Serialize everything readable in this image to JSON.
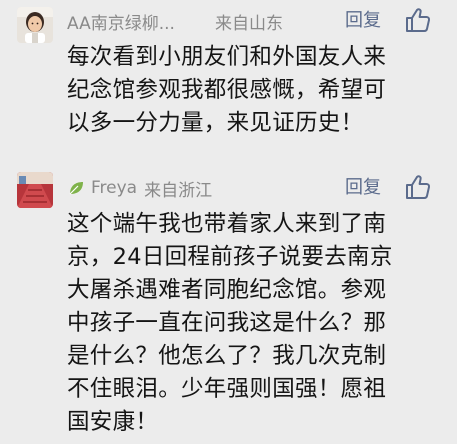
{
  "comments": [
    {
      "nickname": "AA南京绿柳...",
      "location": "来自山东",
      "reply_label": "回复",
      "avatar": "child-photo-avatar",
      "like_icon": "thumbs-up-icon",
      "text_lines": [
        "每次看到小朋友们和外国友人来",
        "纪念馆参观我都很感慨，希望可",
        "以多一分力量，来见证历史！"
      ]
    },
    {
      "nickname": "Freya",
      "location": "来自浙江",
      "reply_label": "回复",
      "avatar": "red-stairs-avatar",
      "badge_icon": "leaf-icon",
      "like_icon": "thumbs-up-icon",
      "text_lines": [
        "这个端午我也带着家人来到了南",
        "京，24日回程前孩子说要去南京",
        "大屠杀遇难者同胞纪念馆。参观",
        "中孩子一直在问我这是什么？那",
        "是什么？他怎么了？我几次克制",
        "不住眼泪。少年强则国强！愿祖",
        "国安康！"
      ]
    }
  ],
  "colors": {
    "background": "#ececec",
    "meta_text": "#8a8a8a",
    "reply_link": "#5b6b8c",
    "body_text": "#151515"
  }
}
